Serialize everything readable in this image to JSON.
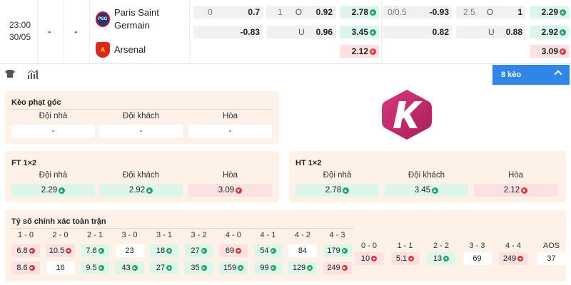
{
  "match": {
    "time": "23:00",
    "date": "30/05",
    "score1": "-",
    "score2": "-",
    "home": "Paris Saint Germain",
    "home_line1": "Paris Saint",
    "home_line2": "Germain",
    "away": "Arsenal",
    "ft": {
      "hdp_line": "0",
      "hdp_home": "0.7",
      "hdp_away": "-0.83",
      "ou_line": "1",
      "ou_o": "O",
      "ou_u": "U",
      "ou_over": "0.92",
      "ou_under": "0.96",
      "x12_home": "2.78",
      "x12_away": "3.45",
      "x12_draw": "2.12"
    },
    "ht": {
      "hdp_line": "0/0.5",
      "hdp_home": "-0.93",
      "hdp_away": "0.82",
      "ou_line": "2.5",
      "ou_o": "O",
      "ou_u": "U",
      "ou_over": "1",
      "ou_under": "0.88",
      "x12_home": "2.29",
      "x12_away": "2.92",
      "x12_draw": "3.09"
    }
  },
  "toolbar": {
    "more_label": "8 kèo"
  },
  "corner": {
    "title": "Kèo phạt góc",
    "headers": [
      "Đội nhà",
      "Đội khách",
      "Hòa"
    ],
    "values": [
      "-",
      "-",
      "-"
    ]
  },
  "ft12": {
    "title": "FT 1×2",
    "headers": [
      "Đội nhà",
      "Đội khách",
      "Hòa"
    ],
    "values": [
      "2.29",
      "2.92",
      "3.09"
    ]
  },
  "ht12": {
    "title": "HT 1×2",
    "headers": [
      "Đội nhà",
      "Đội khách",
      "Hòa"
    ],
    "values": [
      "2.78",
      "3.45",
      "2.12"
    ]
  },
  "exact": {
    "title": "Tỷ số chính xác toàn trận",
    "home_win": {
      "labels": [
        "1 - 0",
        "2 - 0",
        "2 - 1",
        "3 - 0",
        "3 - 1",
        "3 - 2",
        "4 - 0",
        "4 - 1",
        "4 - 2",
        "4 - 3"
      ],
      "row1": [
        "6.8",
        "10.5",
        "7.6",
        "23",
        "18",
        "27",
        "69",
        "54",
        "84",
        "179"
      ],
      "row2": [
        "8.6",
        "16",
        "9.5",
        "43",
        "27",
        "35",
        "159",
        "99",
        "129",
        "249"
      ]
    },
    "draw": {
      "labels": [
        "0 - 0",
        "1 - 1",
        "2 - 2",
        "3 - 3",
        "4 - 4",
        "AOS"
      ],
      "values": [
        "10",
        "5.1",
        "13",
        "69",
        "249",
        "37"
      ]
    }
  },
  "colors": {
    "accent": "#2f86e8",
    "up": "#23a36a",
    "down": "#d93b3b",
    "panel": "#fdf1e8",
    "logo": "#c72a6e"
  }
}
